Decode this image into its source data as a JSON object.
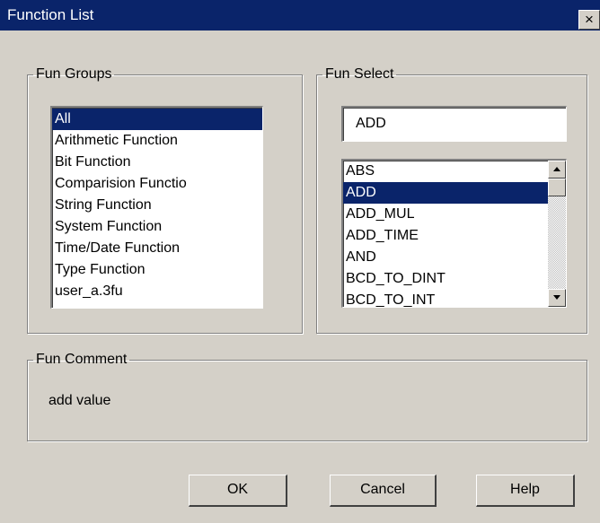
{
  "window": {
    "title": "Function List",
    "close_glyph": "×"
  },
  "fun_groups": {
    "legend": "Fun Groups",
    "items": [
      {
        "label": "All",
        "selected": true
      },
      {
        "label": "Arithmetic Function",
        "selected": false
      },
      {
        "label": "Bit Function",
        "selected": false
      },
      {
        "label": "Comparision Functio",
        "selected": false
      },
      {
        "label": "String Function",
        "selected": false
      },
      {
        "label": "System Function",
        "selected": false
      },
      {
        "label": "Time/Date Function",
        "selected": false
      },
      {
        "label": "Type Function",
        "selected": false
      },
      {
        "label": "user_a.3fu",
        "selected": false
      }
    ]
  },
  "fun_select": {
    "legend": "Fun Select",
    "value": "ADD",
    "items": [
      {
        "label": "ABS",
        "selected": false
      },
      {
        "label": "ADD",
        "selected": true
      },
      {
        "label": "ADD_MUL",
        "selected": false
      },
      {
        "label": "ADD_TIME",
        "selected": false
      },
      {
        "label": "AND",
        "selected": false
      },
      {
        "label": "BCD_TO_DINT",
        "selected": false
      },
      {
        "label": "BCD_TO_INT",
        "selected": false
      }
    ]
  },
  "fun_comment": {
    "legend": "Fun Comment",
    "text": "add value"
  },
  "buttons": {
    "ok": "OK",
    "cancel": "Cancel",
    "help": "Help"
  },
  "colors": {
    "titlebar": "#0a246a",
    "selection": "#0a246a",
    "face": "#d4d0c8"
  }
}
